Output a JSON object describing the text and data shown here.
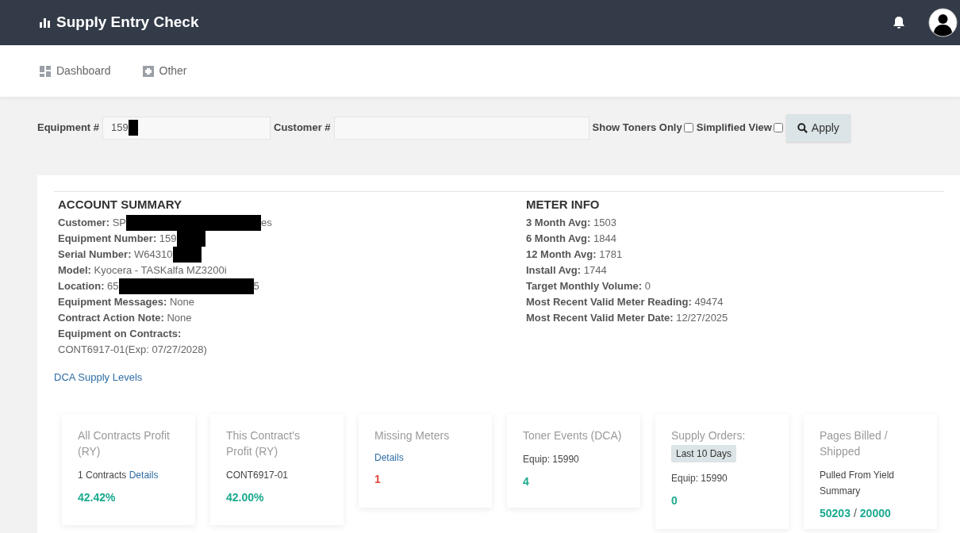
{
  "app": {
    "title": "Supply Entry Check"
  },
  "nav": [
    {
      "label": "Dashboard"
    },
    {
      "label": "Other"
    }
  ],
  "filters": {
    "equipment_label": "Equipment #",
    "equipment_value": "159",
    "equipment_redacted": true,
    "customer_label": "Customer #",
    "checkboxes": [
      {
        "label": "Show Toners Only",
        "checked": false
      },
      {
        "label": "Simplified View",
        "checked": false
      }
    ],
    "apply": "Apply"
  },
  "account_summary": {
    "title": "ACCOUNT SUMMARY",
    "fields": [
      {
        "label": "Customer:",
        "value": "SP",
        "redacted": true,
        "value_after": "es"
      },
      {
        "label": "Equipment Number:",
        "value": "159",
        "redacted": true
      },
      {
        "label": "Serial Number:",
        "value": "W64310",
        "redacted": true
      },
      {
        "label": "Model:",
        "value": "Kyocera - TASKalfa MZ3200i",
        "redacted": false
      },
      {
        "label": "Location:",
        "value": "65",
        "redacted": true,
        "value_after": "5"
      },
      {
        "label": "Equipment Messages:",
        "value": "None",
        "redacted": false
      },
      {
        "label": "Contract Action Note:",
        "value": "None",
        "redacted": false
      },
      {
        "label": "Equipment on Contracts:",
        "redacted": false
      }
    ],
    "contract_line": "CONT6917-01(Exp: 07/27/2028)"
  },
  "meter_info": {
    "title": "METER INFO",
    "fields": [
      {
        "label": "3 Month Avg:",
        "value": "1503"
      },
      {
        "label": "6 Month Avg:",
        "value": "1844"
      },
      {
        "label": "12 Month Avg:",
        "value": "1781"
      },
      {
        "label": "Install Avg:",
        "value": "1744"
      },
      {
        "label": "Target Monthly Volume:",
        "value": "0"
      },
      {
        "label": "Most Recent Valid Meter Reading:",
        "value": "49474"
      },
      {
        "label": "Most Recent Valid Meter Date:",
        "value": "12/27/2025"
      }
    ]
  },
  "dca_link": "DCA Supply Levels",
  "cards": [
    {
      "title": "All Contracts Profit (RY)",
      "sub": "1 Contracts",
      "sub_link": "Details",
      "value": "42.42%",
      "color": "#1aaa8e"
    },
    {
      "title": "This Contract's Profit (RY)",
      "sub": "CONT6917-01",
      "value": "42.00%",
      "color": "#1aaa8e"
    },
    {
      "title": "Missing Meters",
      "link": "Details",
      "value": "1",
      "color": "#e0483a"
    },
    {
      "title": "Toner Events (DCA)",
      "sub": "Equip: 15990",
      "value": "4",
      "color": "#1aaa8e"
    },
    {
      "title": "Supply Orders:",
      "badge": "Last 10 Days",
      "sub": "Equip: 15990",
      "value": "0",
      "color": "#1aaa8e"
    },
    {
      "title": "Pages Billed / Shipped",
      "sub": "Pulled From Yield Summary",
      "value": "50203",
      "separator": "/",
      "value_2": "20000",
      "color": "#1aaa8e"
    }
  ]
}
